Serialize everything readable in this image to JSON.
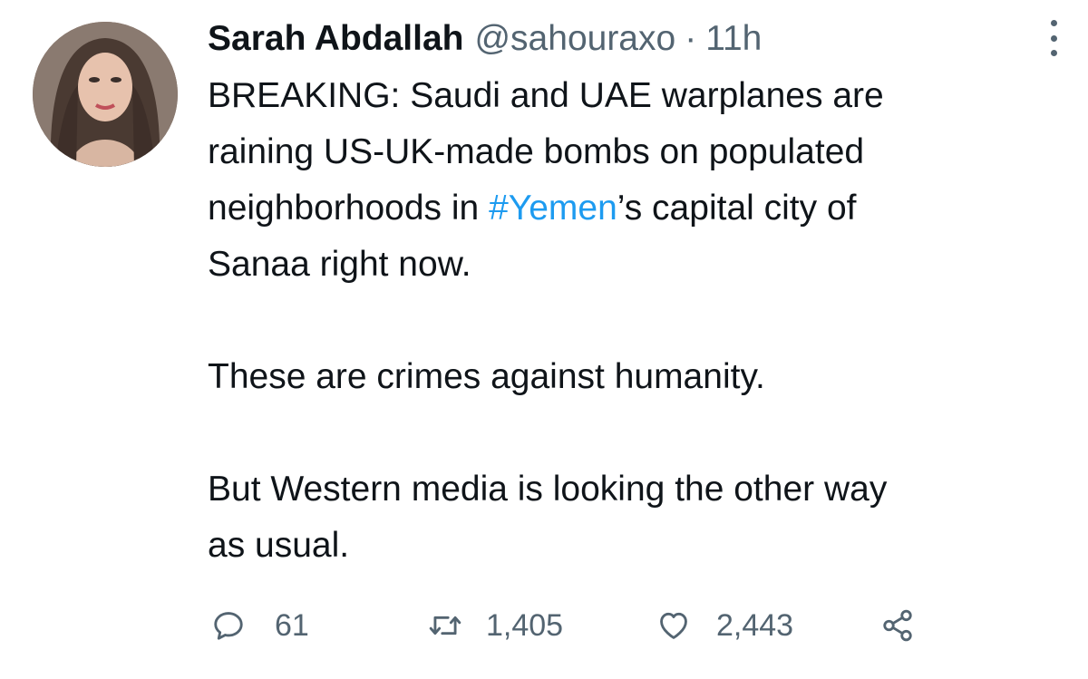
{
  "tweet": {
    "author": {
      "name": "Sarah Abdallah",
      "handle": "@sahouraxo",
      "separator": "·",
      "time": "11h"
    },
    "text": {
      "line1": "BREAKING: Saudi and UAE warplanes are",
      "line2": "raining US-UK-made bombs on populated",
      "line3_before": "neighborhoods in ",
      "hashtag": "#Yemen",
      "line3_after": "’s capital city of",
      "line4": "Sanaa right now.",
      "paragraph2": "These are crimes against humanity.",
      "paragraph3_line1": "But Western media is looking the other way",
      "paragraph3_line2": "as usual."
    },
    "actions": {
      "replies": "61",
      "retweets": "1,405",
      "likes": "2,443"
    }
  },
  "colors": {
    "text": "#0f1419",
    "secondary": "#536471",
    "link": "#1d9bf0"
  },
  "icons": [
    "more-icon",
    "reply-icon",
    "retweet-icon",
    "like-icon",
    "share-icon"
  ]
}
